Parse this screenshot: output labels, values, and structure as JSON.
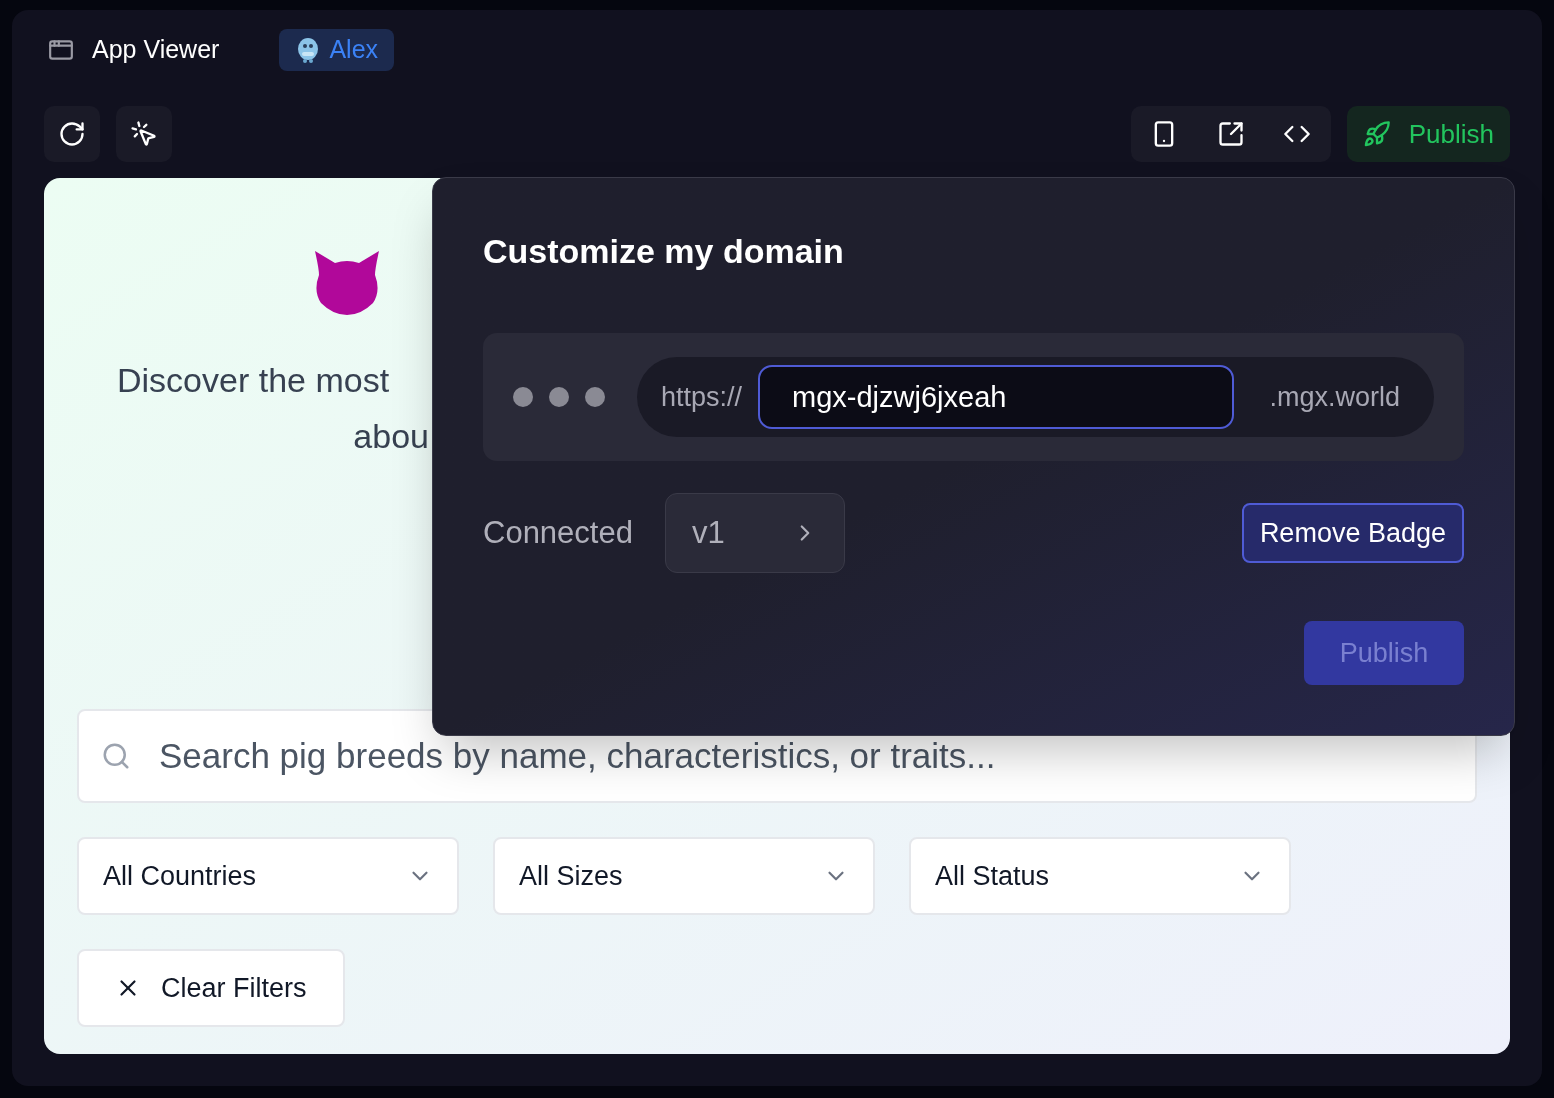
{
  "header": {
    "title": "App Viewer",
    "user": "Alex"
  },
  "toolbar": {
    "publish": "Publish"
  },
  "preview": {
    "subtitle_lines": [
      "Discover the most",
      "abou"
    ],
    "search": {
      "placeholder": "Search pig breeds by name, characteristics, or traits..."
    },
    "filters": [
      "All Countries",
      "All Sizes",
      "All Status"
    ],
    "clear": "Clear Filters"
  },
  "dialog": {
    "title": "Customize my domain",
    "scheme": "https://",
    "subdomain": "mgx-djzwj6jxeah",
    "suffix": ".mgx.world",
    "status": "Connected",
    "version": "v1",
    "remove_badge": "Remove Badge",
    "publish": {
      "label": "Publish",
      "disabled": true
    }
  }
}
